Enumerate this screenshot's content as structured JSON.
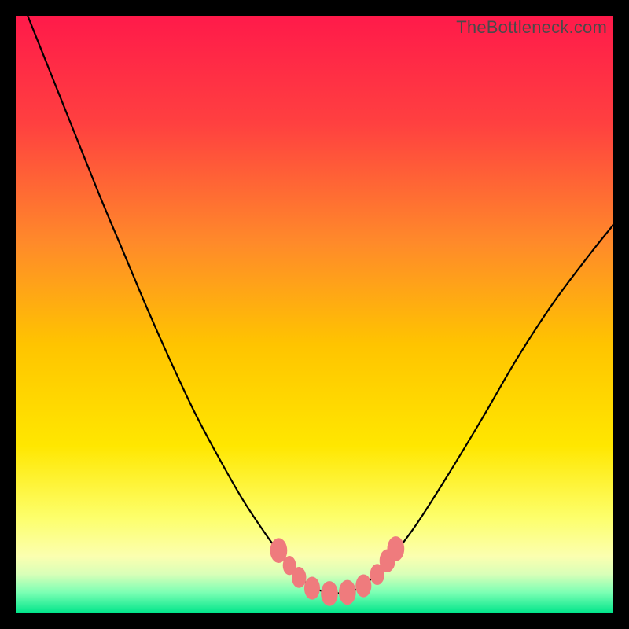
{
  "watermark": "TheBottleneck.com",
  "gradient": {
    "stops": [
      {
        "offset": 0,
        "color": "#ff1a4a"
      },
      {
        "offset": 0.18,
        "color": "#ff4040"
      },
      {
        "offset": 0.38,
        "color": "#ff8a2a"
      },
      {
        "offset": 0.55,
        "color": "#ffc400"
      },
      {
        "offset": 0.72,
        "color": "#ffe700"
      },
      {
        "offset": 0.84,
        "color": "#fdff6b"
      },
      {
        "offset": 0.905,
        "color": "#fbffb0"
      },
      {
        "offset": 0.935,
        "color": "#d8ffb8"
      },
      {
        "offset": 0.965,
        "color": "#7cffb4"
      },
      {
        "offset": 1.0,
        "color": "#00e58a"
      }
    ]
  },
  "chart_data": {
    "type": "line",
    "title": "",
    "xlabel": "",
    "ylabel": "",
    "xlim": [
      0,
      100
    ],
    "ylim": [
      0,
      100
    ],
    "note": "Values estimated from pixels; y=100 at top, y=0 at bottom. Two curve segments meeting near x≈52.",
    "series": [
      {
        "name": "left-branch",
        "x": [
          2,
          6,
          10,
          14,
          18,
          22,
          26,
          30,
          34,
          38,
          42,
          45,
          47,
          49,
          51,
          53
        ],
        "y": [
          100,
          90,
          80,
          70,
          60.5,
          51,
          42,
          33.5,
          26,
          19,
          13,
          9,
          6.5,
          4.8,
          3.8,
          3.3
        ]
      },
      {
        "name": "right-branch",
        "x": [
          53,
          56,
          58,
          60,
          63,
          67,
          72,
          78,
          84,
          90,
          96,
          100
        ],
        "y": [
          3.3,
          3.6,
          4.6,
          6.2,
          9.5,
          14.8,
          22.6,
          32.5,
          42.8,
          52.0,
          60.0,
          65.0
        ]
      }
    ],
    "markers": {
      "name": "highlight-points",
      "color": "#ef7b7d",
      "points": [
        {
          "x": 44.0,
          "y": 10.5,
          "r": 1.3
        },
        {
          "x": 45.8,
          "y": 8.0,
          "r": 1.0
        },
        {
          "x": 47.4,
          "y": 6.0,
          "r": 1.1
        },
        {
          "x": 49.6,
          "y": 4.2,
          "r": 1.2
        },
        {
          "x": 52.5,
          "y": 3.3,
          "r": 1.3
        },
        {
          "x": 55.5,
          "y": 3.5,
          "r": 1.3
        },
        {
          "x": 58.2,
          "y": 4.6,
          "r": 1.2
        },
        {
          "x": 60.5,
          "y": 6.5,
          "r": 1.1
        },
        {
          "x": 62.2,
          "y": 8.8,
          "r": 1.2
        },
        {
          "x": 63.6,
          "y": 10.8,
          "r": 1.3
        }
      ]
    }
  }
}
